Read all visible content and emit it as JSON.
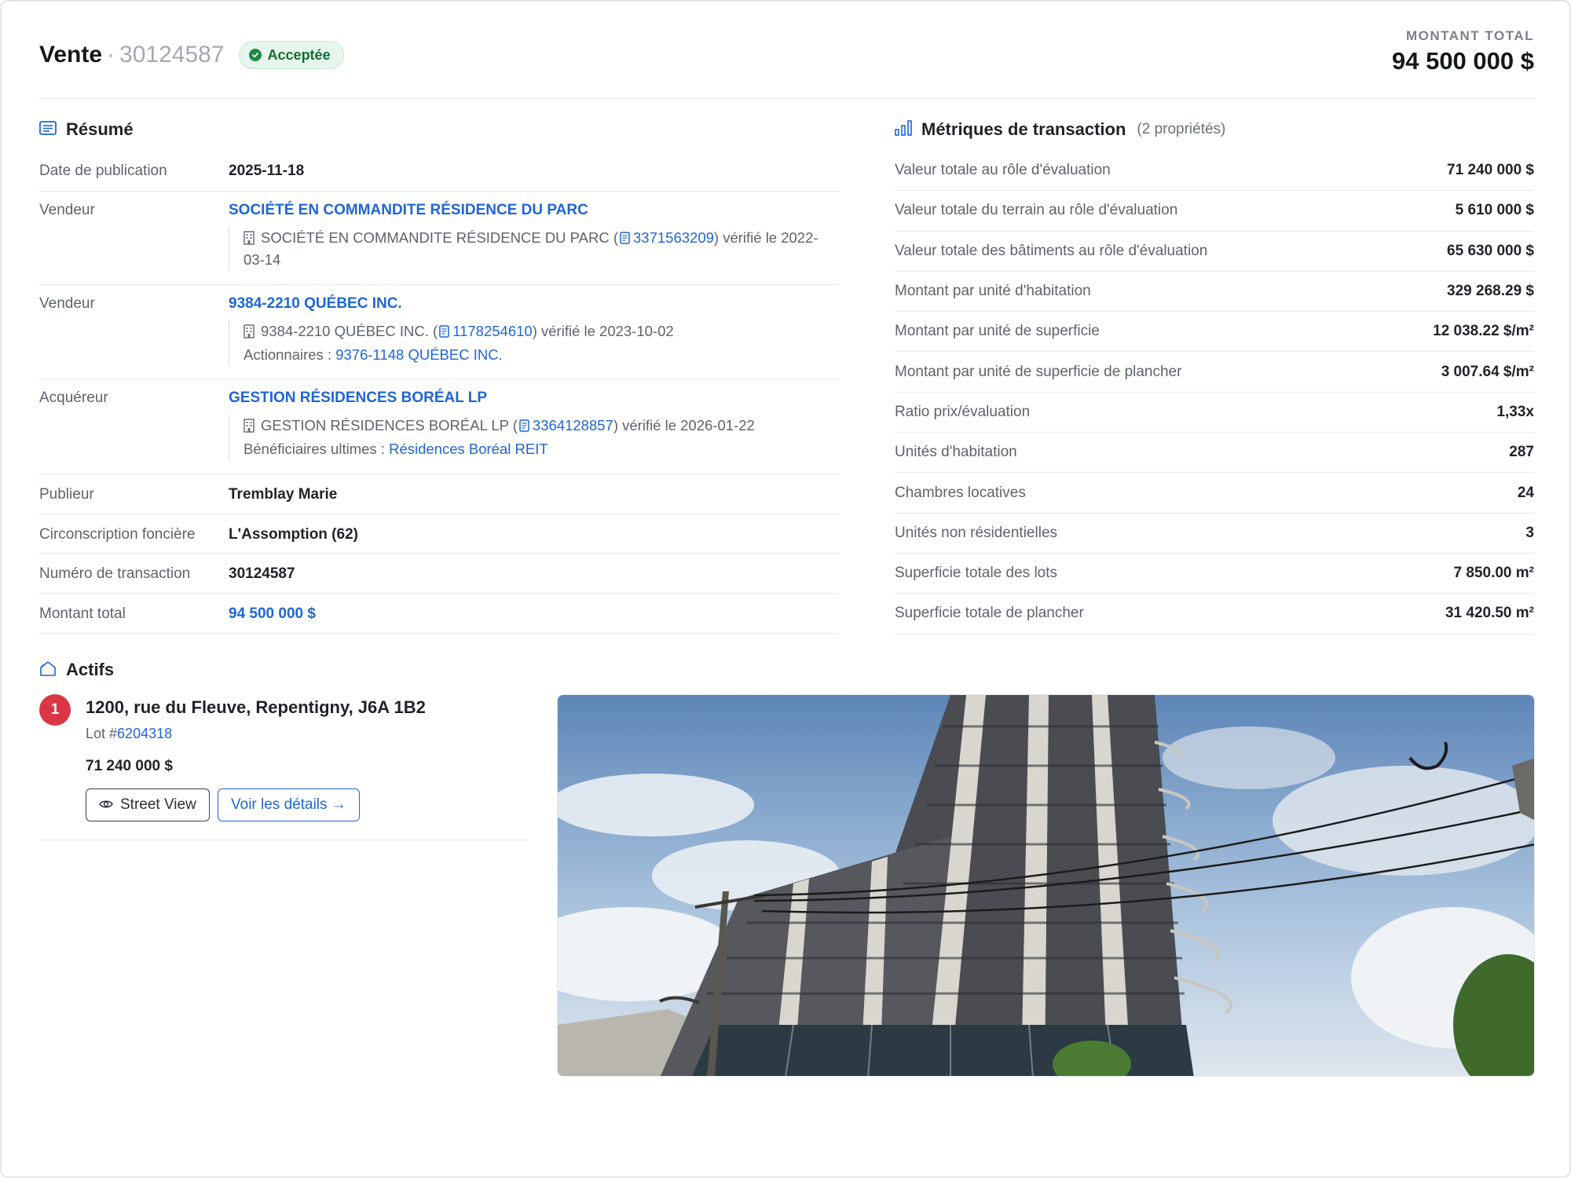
{
  "header": {
    "title": "Vente",
    "separator": "·",
    "transaction_number": "30124587",
    "status": "Acceptée",
    "total_label": "MONTANT TOTAL",
    "total_value": "94 500 000 $"
  },
  "summary": {
    "title": "Résumé",
    "date_label": "Date de publication",
    "date_value": "2025-11-18",
    "seller1": {
      "label": "Vendeur",
      "name": "SOCIÉTÉ EN COMMANDITE RÉSIDENCE DU PARC",
      "detail_name": "SOCIÉTÉ EN COMMANDITE RÉSIDENCE DU PARC (",
      "neq": "3371563209",
      "verified": ") vérifié le 2022-",
      "verified_cont": "03-14"
    },
    "seller2": {
      "label": "Vendeur",
      "name": "9384-2210 QUÉBEC INC.",
      "detail_name": "9384-2210 QUÉBEC INC. (",
      "neq": "1178254610",
      "verified": ") vérifié le 2023-10-02",
      "extra_label": "Actionnaires : ",
      "extra_link": "9376-1148 QUÉBEC INC."
    },
    "buyer": {
      "label": "Acquéreur",
      "name": "GESTION RÉSIDENCES BORÉAL LP",
      "detail_name": "GESTION RÉSIDENCES BORÉAL LP (",
      "neq": "3364128857",
      "verified": ") vérifié le 2026-01-22",
      "extra_label": "Bénéficiaires ultimes : ",
      "extra_link": "Résidences Boréal REIT"
    },
    "publisher_label": "Publieur",
    "publisher_value": "Tremblay Marie",
    "district_label": "Circonscription foncière",
    "district_value": "L'Assomption (62)",
    "txn_label": "Numéro de transaction",
    "txn_value": "30124587",
    "amount_label": "Montant total",
    "amount_value": "94 500 000 $"
  },
  "metrics": {
    "title": "Métriques de transaction",
    "subtitle": "(2 propriétés)",
    "rows": [
      {
        "label": "Valeur totale au rôle d'évaluation",
        "value": "71 240 000 $"
      },
      {
        "label": "Valeur totale du terrain au rôle d'évaluation",
        "value": "5 610 000 $"
      },
      {
        "label": "Valeur totale des bâtiments au rôle d'évaluation",
        "value": "65 630 000 $"
      },
      {
        "label": "Montant par unité d'habitation",
        "value": "329 268.29 $"
      },
      {
        "label": "Montant par unité de superficie",
        "value": "12 038.22 $/m²"
      },
      {
        "label": "Montant par unité de superficie de plancher",
        "value": "3 007.64 $/m²"
      },
      {
        "label": "Ratio prix/évaluation",
        "value": "1,33x"
      },
      {
        "label": "Unités d'habitation",
        "value": "287"
      },
      {
        "label": "Chambres locatives",
        "value": "24"
      },
      {
        "label": "Unités non résidentielles",
        "value": "3"
      },
      {
        "label": "Superficie totale des lots",
        "value": "7 850.00 m²"
      },
      {
        "label": "Superficie totale de plancher",
        "value": "31 420.50 m²"
      }
    ]
  },
  "assets": {
    "title": "Actifs",
    "items": [
      {
        "index": "1",
        "address": "1200, rue du Fleuve, Repentigny, J6A 1B2",
        "lot_prefix": "Lot #",
        "lot_number": "6204318",
        "amount": "71 240 000 $",
        "street_view_label": "Street View",
        "details_label": "Voir les détails →"
      }
    ]
  },
  "icons": {
    "status": "check-circle-icon",
    "summary": "list-icon",
    "metrics": "bar-chart-icon",
    "assets": "house-icon",
    "company": "building-icon",
    "registry": "document-icon",
    "street_view": "eye-icon"
  },
  "colors": {
    "accent": "#1f66d1",
    "success_bg": "#e7f6ec",
    "success": "#186a34",
    "marker": "#dc3545"
  }
}
